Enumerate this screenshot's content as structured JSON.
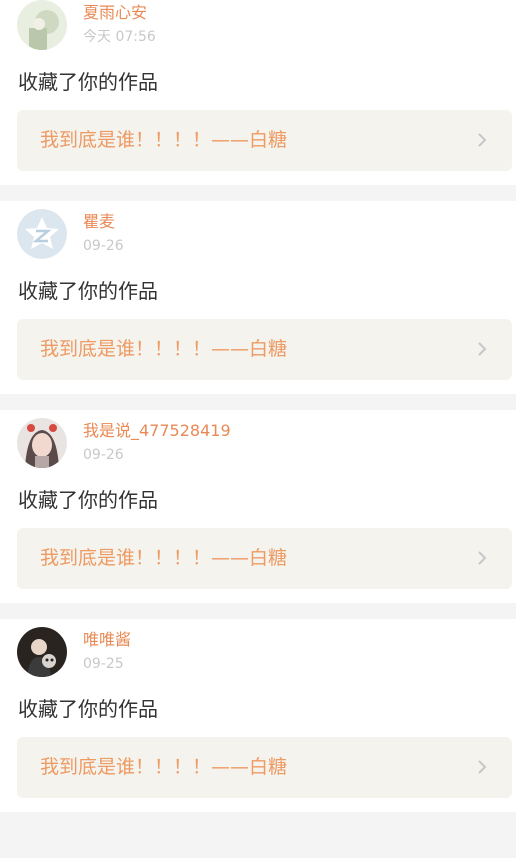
{
  "feed": {
    "items": [
      {
        "username": "夏雨心安",
        "time": "今天 07:56",
        "action": "收藏了你的作品",
        "work_title": "我到底是谁！！！！——白糖",
        "avatar": "photo-avatar-icon"
      },
      {
        "username": "瞿麦",
        "time": "09-26",
        "action": "收藏了你的作品",
        "work_title": "我到底是谁！！！！——白糖",
        "avatar": "default-star-avatar-icon"
      },
      {
        "username": "我是说_477528419",
        "time": "09-26",
        "action": "收藏了你的作品",
        "work_title": "我到底是谁！！！！——白糖",
        "avatar": "photo-avatar-icon"
      },
      {
        "username": "唯唯酱",
        "time": "09-25",
        "action": "收藏了你的作品",
        "work_title": "我到底是谁！！！！——白糖",
        "avatar": "photo-avatar-icon"
      }
    ]
  },
  "colors": {
    "username": "#e98a55",
    "work_title": "#ee9a63",
    "card_bg": "#ffffff",
    "link_bg": "#f4f3ee",
    "page_bg": "#f4f4f4"
  }
}
